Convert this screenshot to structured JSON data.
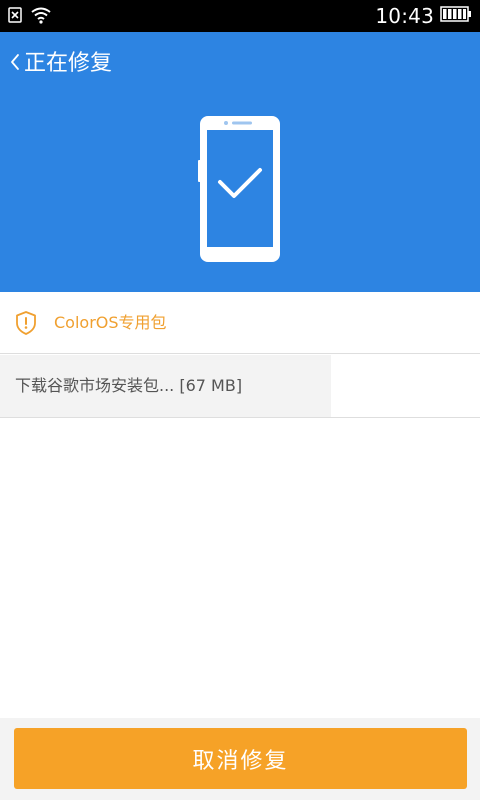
{
  "status_bar": {
    "time": "10:43",
    "icons": {
      "notification": "close-box-icon",
      "wifi": "wifi-icon",
      "battery": "battery-icon"
    },
    "battery_level": 1.0
  },
  "header": {
    "back_icon": "chevron-left-icon",
    "title": "正在修复",
    "illustration": "phone-check-icon",
    "background_color": "#2d84e2"
  },
  "package": {
    "icon": "shield-alert-icon",
    "label": "ColorOS专用包",
    "accent_color": "#f0a030"
  },
  "download": {
    "text": "下载谷歌市场安装包... [67 MB]",
    "progress": 0.69
  },
  "footer": {
    "cancel_label": "取消修复",
    "button_color": "#f6a227"
  }
}
